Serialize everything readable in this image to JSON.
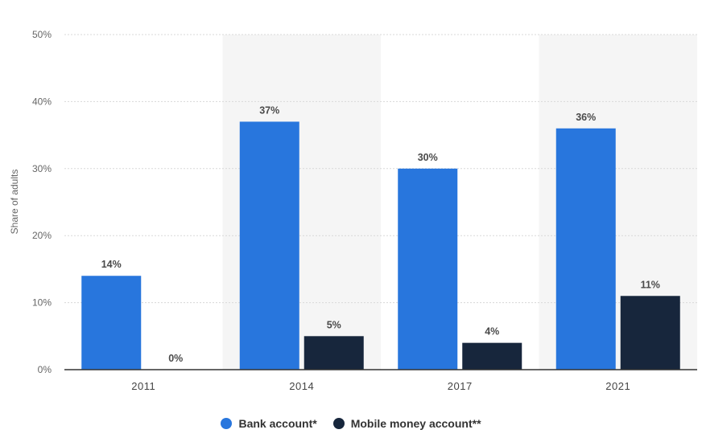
{
  "chart_data": {
    "type": "bar",
    "categories": [
      "2011",
      "2014",
      "2017",
      "2021"
    ],
    "series": [
      {
        "name": "Bank account*",
        "values": [
          14,
          37,
          30,
          36
        ],
        "value_labels": [
          "14%",
          "37%",
          "30%",
          "36%"
        ],
        "color": "#2876dd"
      },
      {
        "name": "Mobile money account**",
        "values": [
          0,
          5,
          4,
          11
        ],
        "value_labels": [
          "0%",
          "5%",
          "4%",
          "11%"
        ],
        "color": "#17263c"
      }
    ],
    "title": "",
    "xlabel": "",
    "ylabel": "Share of adults",
    "ylim": [
      0,
      50
    ],
    "yticks": [
      0,
      10,
      20,
      30,
      40,
      50
    ],
    "ytick_labels": [
      "0%",
      "10%",
      "20%",
      "30%",
      "40%",
      "50%"
    ],
    "grid": true,
    "legend_position": "bottom",
    "colors": {
      "band": "#f5f5f5",
      "grid": "#d8d8d8",
      "axis": "#333333"
    }
  }
}
